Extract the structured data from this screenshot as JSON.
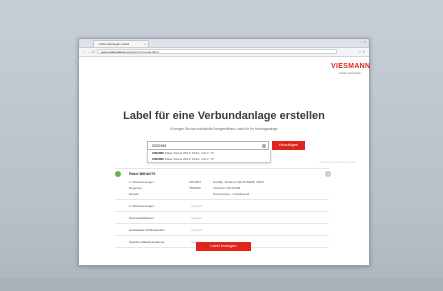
{
  "browser": {
    "tab_title": "Verbundanlagen-Label",
    "tab_close": "×",
    "window_controls": "–  ×",
    "back": "←",
    "forward": "→",
    "reload": "C",
    "url_domain": "www.heatinglabels.com",
    "url_path": "/de/composed-label",
    "tools": "☆ ≡"
  },
  "brand": {
    "logo": "VIESMANN",
    "tagline": "climate of innovation"
  },
  "header": {
    "title": "Label für eine Verbundanlage erstellen",
    "subtitle": "Erzeugen Sie das individuelle Energieeffizienz-Label für Ihr Heizungsanlage"
  },
  "search": {
    "value": "Z002965",
    "clear": "×",
    "add_label": "Hinzufügen",
    "suggestions": [
      {
        "code": "Z002965",
        "text": "Paket Vitosol 200-F SV2A, 4.5m², TV"
      },
      {
        "code": "Z002966",
        "text": "Paket Vitosol 200-F SV2A, 4.5m², TV"
      }
    ],
    "hint": "Artikelnummer oder Paketnummer"
  },
  "package": {
    "name": "Paket B8HA075",
    "remove": "×",
    "rows": [
      {
        "label": "1. Wärmeerzeuger",
        "code": "Z014664",
        "desc": "Gerätlg. Vitodens 200-W B2HB, 19kW"
      },
      {
        "label": "Regelung",
        "code": "7502000",
        "desc": "Vitotronic 200 HO1B"
      },
      {
        "label": "Einsatz",
        "code": "",
        "desc": "Sonnenhaus - modulierend"
      }
    ]
  },
  "optional_rows": [
    {
      "label": "2. Wärmeerzeuger",
      "value": "optional"
    },
    {
      "label": "Sonnenkollektoren",
      "value": "optional"
    },
    {
      "label": "Heizwasser-Pufferspeicher",
      "value": "optional"
    },
    {
      "label": "Speicher-Wassererwärmer",
      "value": "optional"
    }
  ],
  "actions": {
    "generate_label": "Label erzeugen"
  },
  "colors": {
    "brand_red": "#e2231a",
    "status_green": "#6ab04c"
  }
}
